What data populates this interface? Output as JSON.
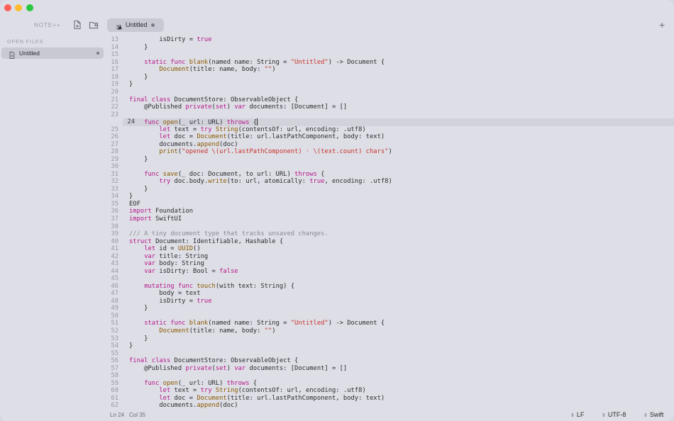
{
  "app": {
    "name": "NOTE++"
  },
  "tab": {
    "label": "Untitled"
  },
  "sidebar": {
    "section_title": "OPEN FILES",
    "files": [
      {
        "label": "Untitled"
      }
    ]
  },
  "status": {
    "ln": "Ln 24",
    "col": "Col 35",
    "line_ending": "LF",
    "encoding": "UTF-8",
    "language": "Swift"
  },
  "editor": {
    "current_line": 24,
    "lines": [
      {
        "n": "13",
        "t": "        isDirty = true"
      },
      {
        "n": "14",
        "t": "    }"
      },
      {
        "n": "15",
        "t": ""
      },
      {
        "n": "16",
        "t": "    static func blank(named name: String = \"Untitled\") -> Document {"
      },
      {
        "n": "17",
        "t": "        Document(title: name, body: \"\")"
      },
      {
        "n": "18",
        "t": "    }"
      },
      {
        "n": "19",
        "t": "}"
      },
      {
        "n": "20",
        "t": ""
      },
      {
        "n": "21",
        "t": "final class DocumentStore: ObservableObject {"
      },
      {
        "n": "22",
        "t": "    @Published private(set) var documents: [Document] = []"
      },
      {
        "n": "23",
        "t": ""
      },
      {
        "n": "24",
        "t": "    func open(_ url: URL) throws {"
      },
      {
        "n": "25",
        "t": "        let text = try String(contentsOf: url, encoding: .utf8)"
      },
      {
        "n": "26",
        "t": "        let doc = Document(title: url.lastPathComponent, body: text)"
      },
      {
        "n": "27",
        "t": "        documents.append(doc)"
      },
      {
        "n": "28",
        "t": "        print(\"opened \\(url.lastPathComponent) · \\(text.count) chars\")"
      },
      {
        "n": "29",
        "t": "    }"
      },
      {
        "n": "30",
        "t": ""
      },
      {
        "n": "31",
        "t": "    func save(_ doc: Document, to url: URL) throws {"
      },
      {
        "n": "32",
        "t": "        try doc.body.write(to: url, atomically: true, encoding: .utf8)"
      },
      {
        "n": "33",
        "t": "    }"
      },
      {
        "n": "34",
        "t": "}"
      },
      {
        "n": "35",
        "t": "EOF"
      },
      {
        "n": "36",
        "t": "import Foundation"
      },
      {
        "n": "37",
        "t": "import SwiftUI"
      },
      {
        "n": "38",
        "t": ""
      },
      {
        "n": "39",
        "t": "/// A tiny document type that tracks unsaved changes."
      },
      {
        "n": "40",
        "t": "struct Document: Identifiable, Hashable {"
      },
      {
        "n": "41",
        "t": "    let id = UUID()"
      },
      {
        "n": "42",
        "t": "    var title: String"
      },
      {
        "n": "43",
        "t": "    var body: String"
      },
      {
        "n": "44",
        "t": "    var isDirty: Bool = false"
      },
      {
        "n": "45",
        "t": ""
      },
      {
        "n": "46",
        "t": "    mutating func touch(with text: String) {"
      },
      {
        "n": "47",
        "t": "        body = text"
      },
      {
        "n": "48",
        "t": "        isDirty = true"
      },
      {
        "n": "49",
        "t": "    }"
      },
      {
        "n": "50",
        "t": ""
      },
      {
        "n": "51",
        "t": "    static func blank(named name: String = \"Untitled\") -> Document {"
      },
      {
        "n": "52",
        "t": "        Document(title: name, body: \"\")"
      },
      {
        "n": "53",
        "t": "    }"
      },
      {
        "n": "54",
        "t": "}"
      },
      {
        "n": "55",
        "t": ""
      },
      {
        "n": "56",
        "t": "final class DocumentStore: ObservableObject {"
      },
      {
        "n": "57",
        "t": "    @Published private(set) var documents: [Document] = []"
      },
      {
        "n": "58",
        "t": ""
      },
      {
        "n": "59",
        "t": "    func open(_ url: URL) throws {"
      },
      {
        "n": "60",
        "t": "        let text = try String(contentsOf: url, encoding: .utf8)"
      },
      {
        "n": "61",
        "t": "        let doc = Document(title: url.lastPathComponent, body: text)"
      },
      {
        "n": "62",
        "t": "        documents.append(doc)"
      }
    ]
  }
}
